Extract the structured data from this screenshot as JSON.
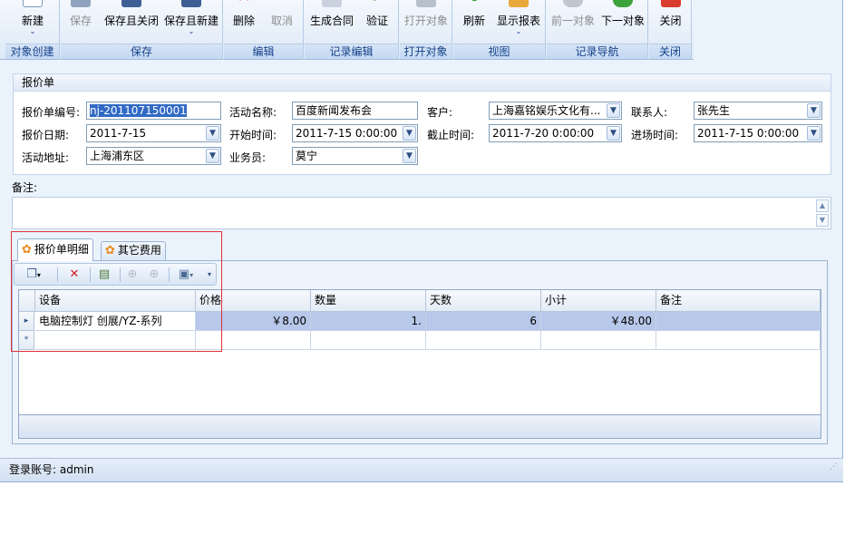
{
  "ribbon": {
    "groups": [
      {
        "label": "对象创建"
      },
      {
        "label": "保存"
      },
      {
        "label": "编辑"
      },
      {
        "label": "记录编辑"
      },
      {
        "label": "打开对象"
      },
      {
        "label": "视图"
      },
      {
        "label": "记录导航"
      },
      {
        "label": "关闭"
      }
    ],
    "buttons": {
      "new": "新建",
      "save": "保存",
      "save_close": "保存且关闭",
      "save_new": "保存且新建",
      "delete": "删除",
      "cancel": "取消",
      "gen_contract": "生成合同",
      "validate": "验证",
      "open_object": "打开对象",
      "refresh": "刷新",
      "show_report": "显示报表",
      "prev_object": "前一对象",
      "next_object": "下一对象",
      "close": "关闭"
    },
    "dropdown_glyph": "⌄"
  },
  "panel": {
    "title": "报价单",
    "labels": {
      "quote_no": "报价单编号:",
      "activity_name": "活动名称:",
      "customer": "客户:",
      "contact": "联系人:",
      "quote_date": "报价日期:",
      "start_time": "开始时间:",
      "end_time": "截止时间:",
      "entry_time": "进场时间:",
      "address": "活动地址:",
      "salesperson": "业务员:"
    },
    "values": {
      "quote_no": "nj-201107150001",
      "activity_name": "百度新闻发布会",
      "customer": "上海嘉铭娱乐文化有...",
      "contact": "张先生",
      "quote_date": "2011-7-15",
      "start_time": "2011-7-15 0:00:00",
      "end_time": "2011-7-20 0:00:00",
      "entry_time": "2011-7-15 0:00:00",
      "address": "上海浦东区",
      "salesperson": "莫宁"
    }
  },
  "remarks": {
    "label": "备注:"
  },
  "tabs": [
    {
      "label": "报价单明细"
    },
    {
      "label": "其它费用"
    }
  ],
  "grid": {
    "columns": [
      "设备",
      "价格",
      "数量",
      "天数",
      "小计",
      "备注"
    ],
    "rows": [
      {
        "device": "电脑控制灯 创展/YZ-系列",
        "price": "￥8.00",
        "qty": "1.",
        "days": "6",
        "subtotal": "￥48.00",
        "note": ""
      }
    ],
    "new_row_marker": "*",
    "current_row_marker": "▸"
  },
  "status": {
    "text": "登录账号: admin"
  }
}
